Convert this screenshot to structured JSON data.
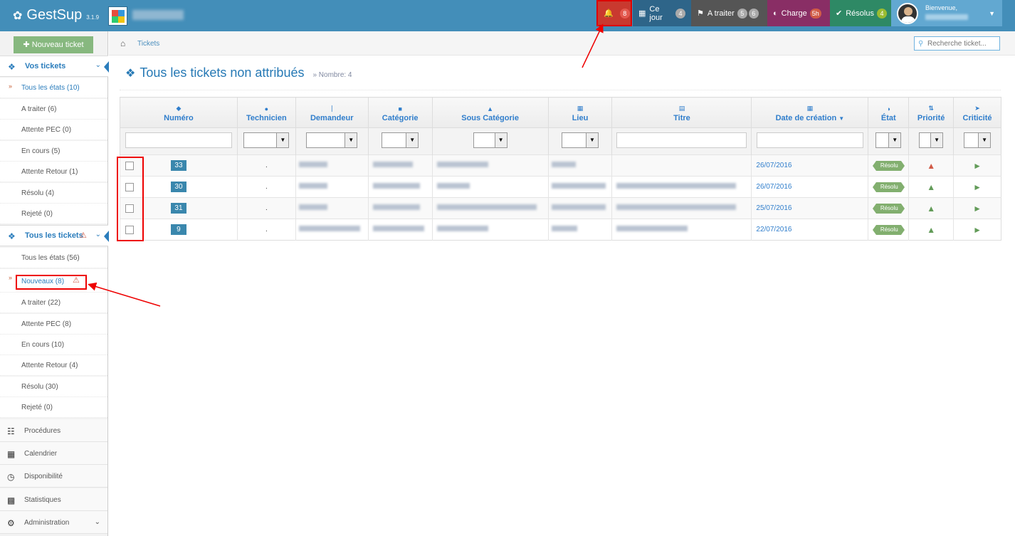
{
  "app": {
    "name": "GestSup",
    "version": "3.1.9"
  },
  "topnav": {
    "notifications": {
      "count": "8"
    },
    "today": {
      "label": "Ce jour",
      "count": "4"
    },
    "todo": {
      "label": "A traiter",
      "count1": "5",
      "count2": "6"
    },
    "charge": {
      "label": "Charge",
      "count": "5h"
    },
    "resolved": {
      "label": "Résolus",
      "count": "4"
    },
    "user": {
      "welcome": "Bienvenue,"
    }
  },
  "sidebar": {
    "new_ticket": "Nouveau ticket",
    "my_tickets": {
      "label": "Vos tickets",
      "items": [
        {
          "label": "Tous les états (10)"
        },
        {
          "label": "A traiter (6)"
        },
        {
          "label": "Attente PEC (0)"
        },
        {
          "label": "En cours (5)"
        },
        {
          "label": "Attente Retour (1)"
        },
        {
          "label": "Résolu (4)"
        },
        {
          "label": "Rejeté (0)"
        }
      ]
    },
    "all_tickets": {
      "label": "Tous les tickets",
      "items": [
        {
          "label": "Tous les états (56)"
        },
        {
          "label": "Nouveaux (8)"
        },
        {
          "label": "A traiter (22)"
        },
        {
          "label": "Attente PEC (8)"
        },
        {
          "label": "En cours (10)"
        },
        {
          "label": "Attente Retour (4)"
        },
        {
          "label": "Résolu (30)"
        },
        {
          "label": "Rejeté (0)"
        }
      ]
    },
    "menu": [
      {
        "label": "Procédures"
      },
      {
        "label": "Calendrier"
      },
      {
        "label": "Disponibilité"
      },
      {
        "label": "Statistiques"
      },
      {
        "label": "Administration"
      }
    ]
  },
  "breadcrumb": {
    "current": "Tickets"
  },
  "search": {
    "placeholder": "Recherche ticket..."
  },
  "page": {
    "title": "Tous les tickets non attribués",
    "count_label": "» Nombre: 4"
  },
  "table": {
    "headers": {
      "numero": "Numéro",
      "technicien": "Technicien",
      "demandeur": "Demandeur",
      "categorie": "Catégorie",
      "sous_categorie": "Sous Catégorie",
      "lieu": "Lieu",
      "titre": "Titre",
      "date": "Date de création",
      "etat": "État",
      "priorite": "Priorité",
      "criticite": "Criticité"
    },
    "rows": [
      {
        "id": "33",
        "tech": ".",
        "date": "26/07/2016",
        "etat": "Résolu",
        "priority": "high"
      },
      {
        "id": "30",
        "tech": ".",
        "date": "26/07/2016",
        "etat": "Résolu",
        "priority": "normal"
      },
      {
        "id": "31",
        "tech": ".",
        "date": "25/07/2016",
        "etat": "Résolu",
        "priority": "normal"
      },
      {
        "id": "9",
        "tech": ".",
        "date": "22/07/2016",
        "etat": "Résolu",
        "priority": "normal"
      }
    ]
  },
  "colors": {
    "topbar": "#438eb9",
    "accent": "#2679b5",
    "resolved_tag": "#82af6f",
    "annotation_red": "#ee0000"
  }
}
